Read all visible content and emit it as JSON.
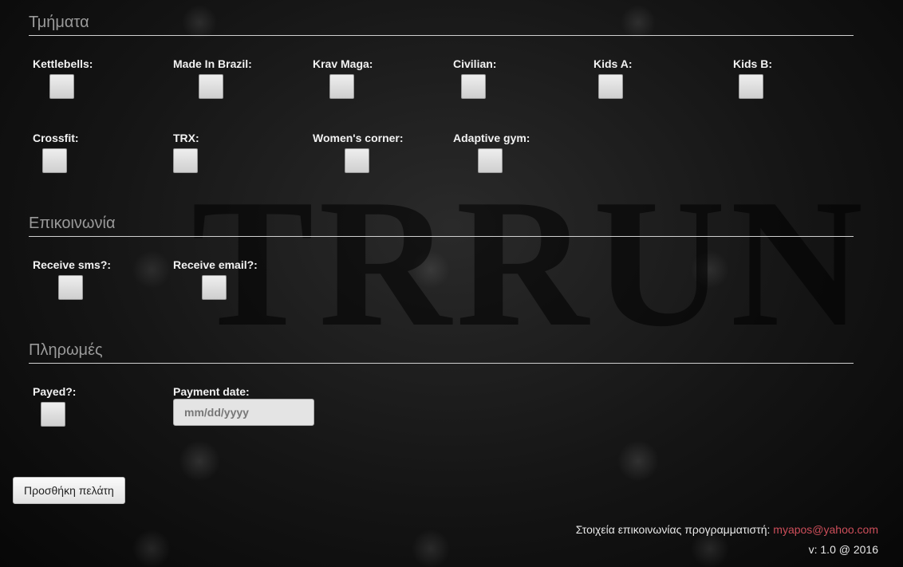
{
  "background": {
    "watermark": "TRRUN"
  },
  "sections": {
    "departments": {
      "title": "Τμήματα",
      "fields": [
        {
          "label": "Kettlebells:"
        },
        {
          "label": "Made In Brazil:"
        },
        {
          "label": "Krav Maga:"
        },
        {
          "label": "Civilian:"
        },
        {
          "label": "Kids A:"
        },
        {
          "label": "Kids B:"
        },
        {
          "label": "Crossfit:"
        },
        {
          "label": "TRX:"
        },
        {
          "label": "Women's corner:"
        },
        {
          "label": "Adaptive gym:"
        }
      ]
    },
    "contact": {
      "title": "Επικοινωνία",
      "fields": [
        {
          "label": "Receive sms?:"
        },
        {
          "label": "Receive email?:"
        }
      ]
    },
    "payments": {
      "title": "Πληρωμές",
      "payed_label": "Payed?:",
      "payment_date_label": "Payment date:",
      "payment_date_placeholder": "mm/dd/yyyy"
    }
  },
  "actions": {
    "add_customer_label": "Προσθήκη πελάτη"
  },
  "footer": {
    "contact_text": "Στοιχεία επικοινωνίας προγραμματιστή:",
    "contact_email": "myapos@yahoo.com",
    "version_text": "v: 1.0 @ 2016"
  },
  "colors": {
    "link": "#cc4e5a",
    "section_title": "#9a9a9a",
    "label": "#f2f2f2"
  }
}
